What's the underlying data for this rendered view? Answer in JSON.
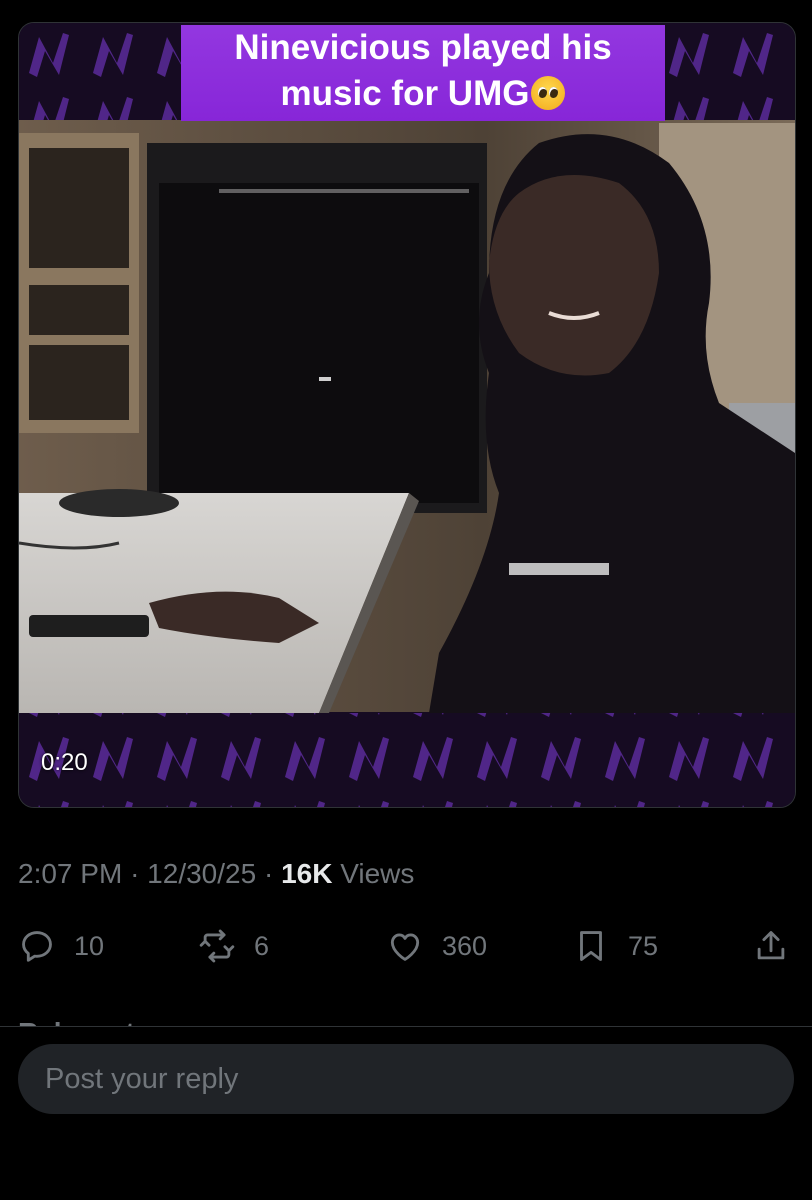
{
  "video": {
    "caption_text": "Ninevicious played his music for UMG",
    "caption_emoji_name": "pleading-face-emoji",
    "caption_color": "#8a2be2",
    "duration": "0:20"
  },
  "meta": {
    "time": "2:07 PM",
    "date": "12/30/25",
    "views_count": "16K",
    "views_label": "Views",
    "separator": "·"
  },
  "actions": {
    "replies": "10",
    "reposts": "6",
    "likes": "360",
    "bookmarks": "75",
    "icons": [
      "reply-icon",
      "repost-icon",
      "like-icon",
      "bookmark-icon",
      "share-icon"
    ]
  },
  "relevant": {
    "label": "Relevant ⌄"
  },
  "reply": {
    "placeholder": "Post your reply"
  },
  "colors": {
    "background": "#000000",
    "muted_text": "#71767b",
    "primary_text": "#e7e9ea",
    "input_bg": "#202327"
  }
}
